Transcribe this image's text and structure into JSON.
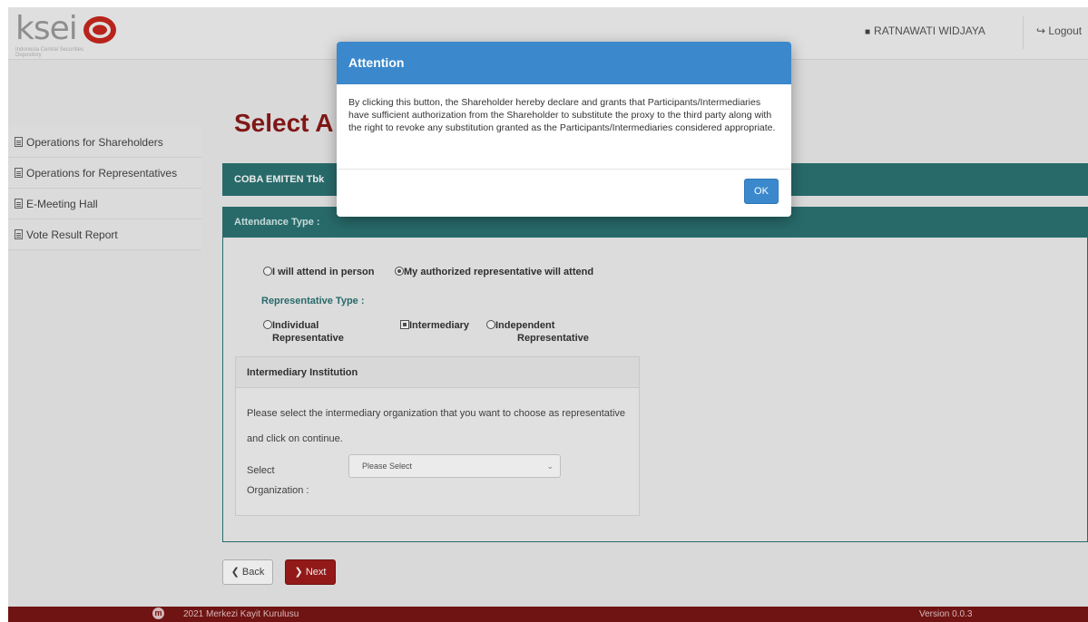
{
  "header": {
    "logo_text": "ksei",
    "logo_subtitle": "Indonesia Central Securities Depository",
    "user_name": "RATNAWATI WIDJAYA",
    "logout_label": "Logout"
  },
  "sidebar": {
    "items": [
      {
        "label": "Operations for Shareholders"
      },
      {
        "label": "Operations for Representatives"
      },
      {
        "label": "E-Meeting Hall"
      },
      {
        "label": "Vote Result Report"
      }
    ]
  },
  "main": {
    "title": "Select A",
    "company_bar": "COBA EMITEN Tbk",
    "attendance": {
      "heading": "Attendance Type :",
      "option_in_person": "I will attend in person",
      "option_representative": "My authorized representative will attend",
      "selected": "representative"
    },
    "representative": {
      "heading": "Representative Type :",
      "options": [
        {
          "line1": "Individual",
          "line2": "Representative",
          "checked": false
        },
        {
          "line1": "Intermediary",
          "line2": "",
          "checked": true
        },
        {
          "line1": "Independent",
          "line2": "Representative",
          "checked": false
        }
      ]
    },
    "intermediary": {
      "heading": "Intermediary Institution",
      "description": "Please select the intermediary organization that you want to choose as representative and click on continue.",
      "select_label_line1": "Select",
      "select_label_line2": "Organization :",
      "select_placeholder": "Please Select"
    },
    "buttons": {
      "back": "Back",
      "next": "Next"
    }
  },
  "footer": {
    "copyright": "2021 Merkezi Kayit Kurulusu",
    "version": "Version 0.0.3"
  },
  "modal": {
    "title": "Attention",
    "body": "By clicking this button, the Shareholder hereby declare and grants that Participants/Intermediaries have sufficient authorization from the Shareholder to substitute the proxy to the third party along with the right to revoke any substitution granted as the Participants/Intermediaries considered appropriate.",
    "ok_label": "OK"
  },
  "colors": {
    "teal": "#2c7474",
    "maroon": "#8b1a1a",
    "modal_blue": "#3b89cc"
  }
}
